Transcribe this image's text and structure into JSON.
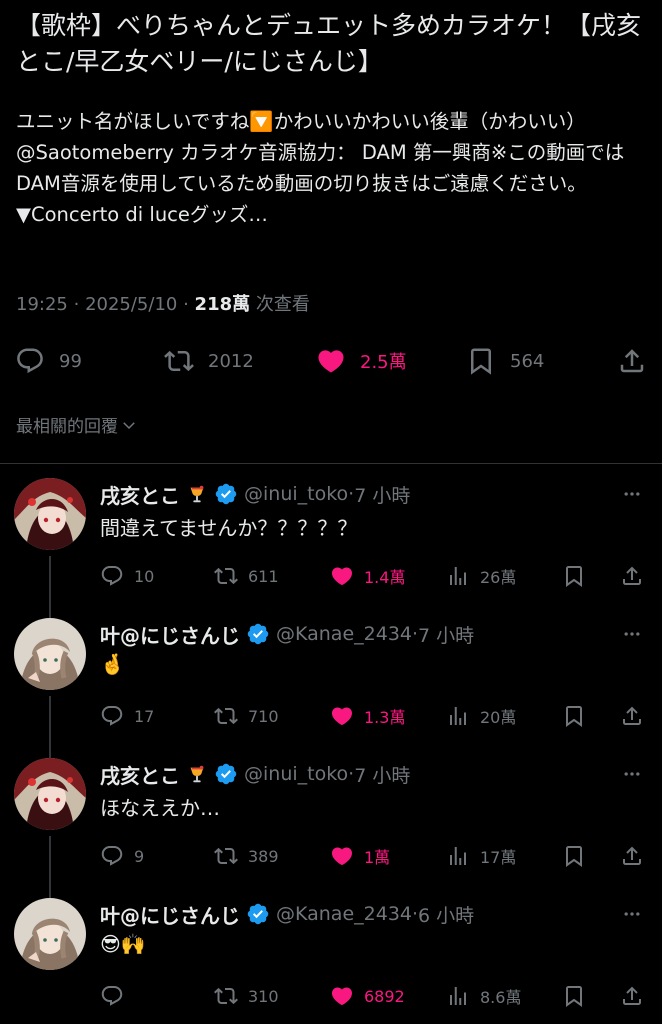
{
  "post": {
    "title": "【歌枠】べりちゃんとデュエット多めカラオケ！【戌亥とこ/早乙女ベリー/にじさんじ】",
    "description": "ユニット名がほしいですね🔽かわいいかわいい後輩（かわいい）@Saotomeberry カラオケ音源協力： DAM 第一興商※この動画ではDAM音源を使用しているため動画の切り抜きはご遠慮ください。▼Concerto di luceグッズ…",
    "time": "19:25",
    "date": "2025/5/10",
    "views": "218萬",
    "views_label": "次查看",
    "stats": {
      "replies": "99",
      "reposts": "2012",
      "likes": "2.5萬",
      "bookmarks": "564"
    }
  },
  "sort_label": "最相關的回覆",
  "replies": [
    {
      "name": "戌亥とこ",
      "badge_emoji": "🍹",
      "handle": "@inui_toko",
      "time": "7 小時",
      "text": "間違えてませんか？？？？？",
      "replies": "10",
      "reposts": "611",
      "likes": "1.4萬",
      "views": "26萬"
    },
    {
      "name": "叶@にじさんじ",
      "handle": "@Kanae_2434",
      "time": "7 小時",
      "text": "🤞",
      "replies": "17",
      "reposts": "710",
      "likes": "1.3萬",
      "views": "20萬"
    },
    {
      "name": "戌亥とこ",
      "badge_emoji": "🍹",
      "handle": "@inui_toko",
      "time": "7 小時",
      "text": "ほなええか…",
      "replies": "9",
      "reposts": "389",
      "likes": "1萬",
      "views": "17萬"
    },
    {
      "name": "叶@にじさんじ",
      "handle": "@Kanae_2434",
      "time": "6 小時",
      "text": "😎🙌",
      "replies": "",
      "reposts": "310",
      "likes": "6892",
      "views": "8.6萬"
    }
  ],
  "colors": {
    "background": "#000000",
    "text": "#e7e9ea",
    "muted": "#71767b",
    "like": "#f91880",
    "verified": "#1d9bf0"
  }
}
